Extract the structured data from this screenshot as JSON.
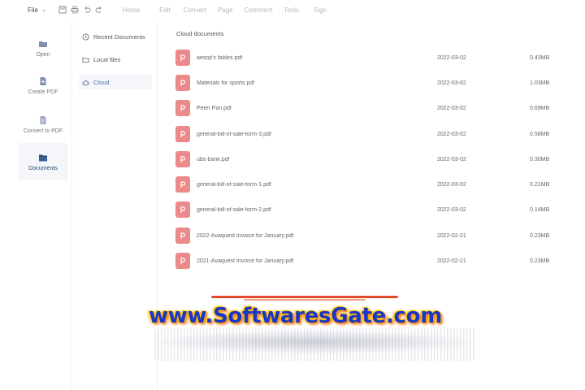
{
  "toolbar": {
    "file_label": "File",
    "icons": [
      "save-icon",
      "print-icon",
      "undo-icon",
      "redo-icon"
    ],
    "menu": [
      "Home",
      "Edit",
      "Convert",
      "Page",
      "Comment",
      "Tools",
      "Sign"
    ]
  },
  "rail": {
    "items": [
      {
        "label": "Open",
        "icon": "folder-icon"
      },
      {
        "label": "Create PDF",
        "icon": "create-pdf-icon"
      },
      {
        "label": "Convert to PDF",
        "icon": "convert-icon"
      },
      {
        "label": "Documents",
        "icon": "documents-icon",
        "active": true
      }
    ]
  },
  "nav": {
    "items": [
      {
        "label": "Recent Documents",
        "icon": "clock-icon"
      },
      {
        "label": "Local files",
        "icon": "folder-icon"
      },
      {
        "label": "Cloud",
        "icon": "cloud-icon",
        "active": true
      }
    ]
  },
  "main": {
    "title": "Cloud documents",
    "files": [
      {
        "name": "aesop's fables.pdf",
        "date": "2022-03-02",
        "size": "0.43MB"
      },
      {
        "name": "Materials for sports.pdf",
        "date": "2022-03-02",
        "size": "1.03MB"
      },
      {
        "name": "Peter Pan.pdf",
        "date": "2022-03-02",
        "size": "0.69MB"
      },
      {
        "name": "general-bill-of-sale-form-3.pdf",
        "date": "2022-03-02",
        "size": "0.58MB"
      },
      {
        "name": "ubs-bank.pdf",
        "date": "2022-03-02",
        "size": "0.30MB"
      },
      {
        "name": "general-bill-of-sale-form-1.pdf",
        "date": "2022-03-02",
        "size": "0.21MB"
      },
      {
        "name": "general-bill-of-sale-form-2.pdf",
        "date": "2022-03-02",
        "size": "0.14MB"
      },
      {
        "name": "2022-Avaquest Invoice for January.pdf",
        "date": "2022-02-21",
        "size": "0.23MB"
      },
      {
        "name": "2021-Avaquest Invoice for January.pdf",
        "date": "2022-02-21",
        "size": "0.23MB"
      }
    ]
  },
  "watermark": {
    "text": "www.SoftwaresGate.com"
  },
  "colors": {
    "pdf_icon": "#ec8a8a",
    "active_bg": "#f4f6f9",
    "active_text": "#4a6ea9",
    "watermark_text": "#1a35c8",
    "watermark_glow": "#ffd400"
  }
}
